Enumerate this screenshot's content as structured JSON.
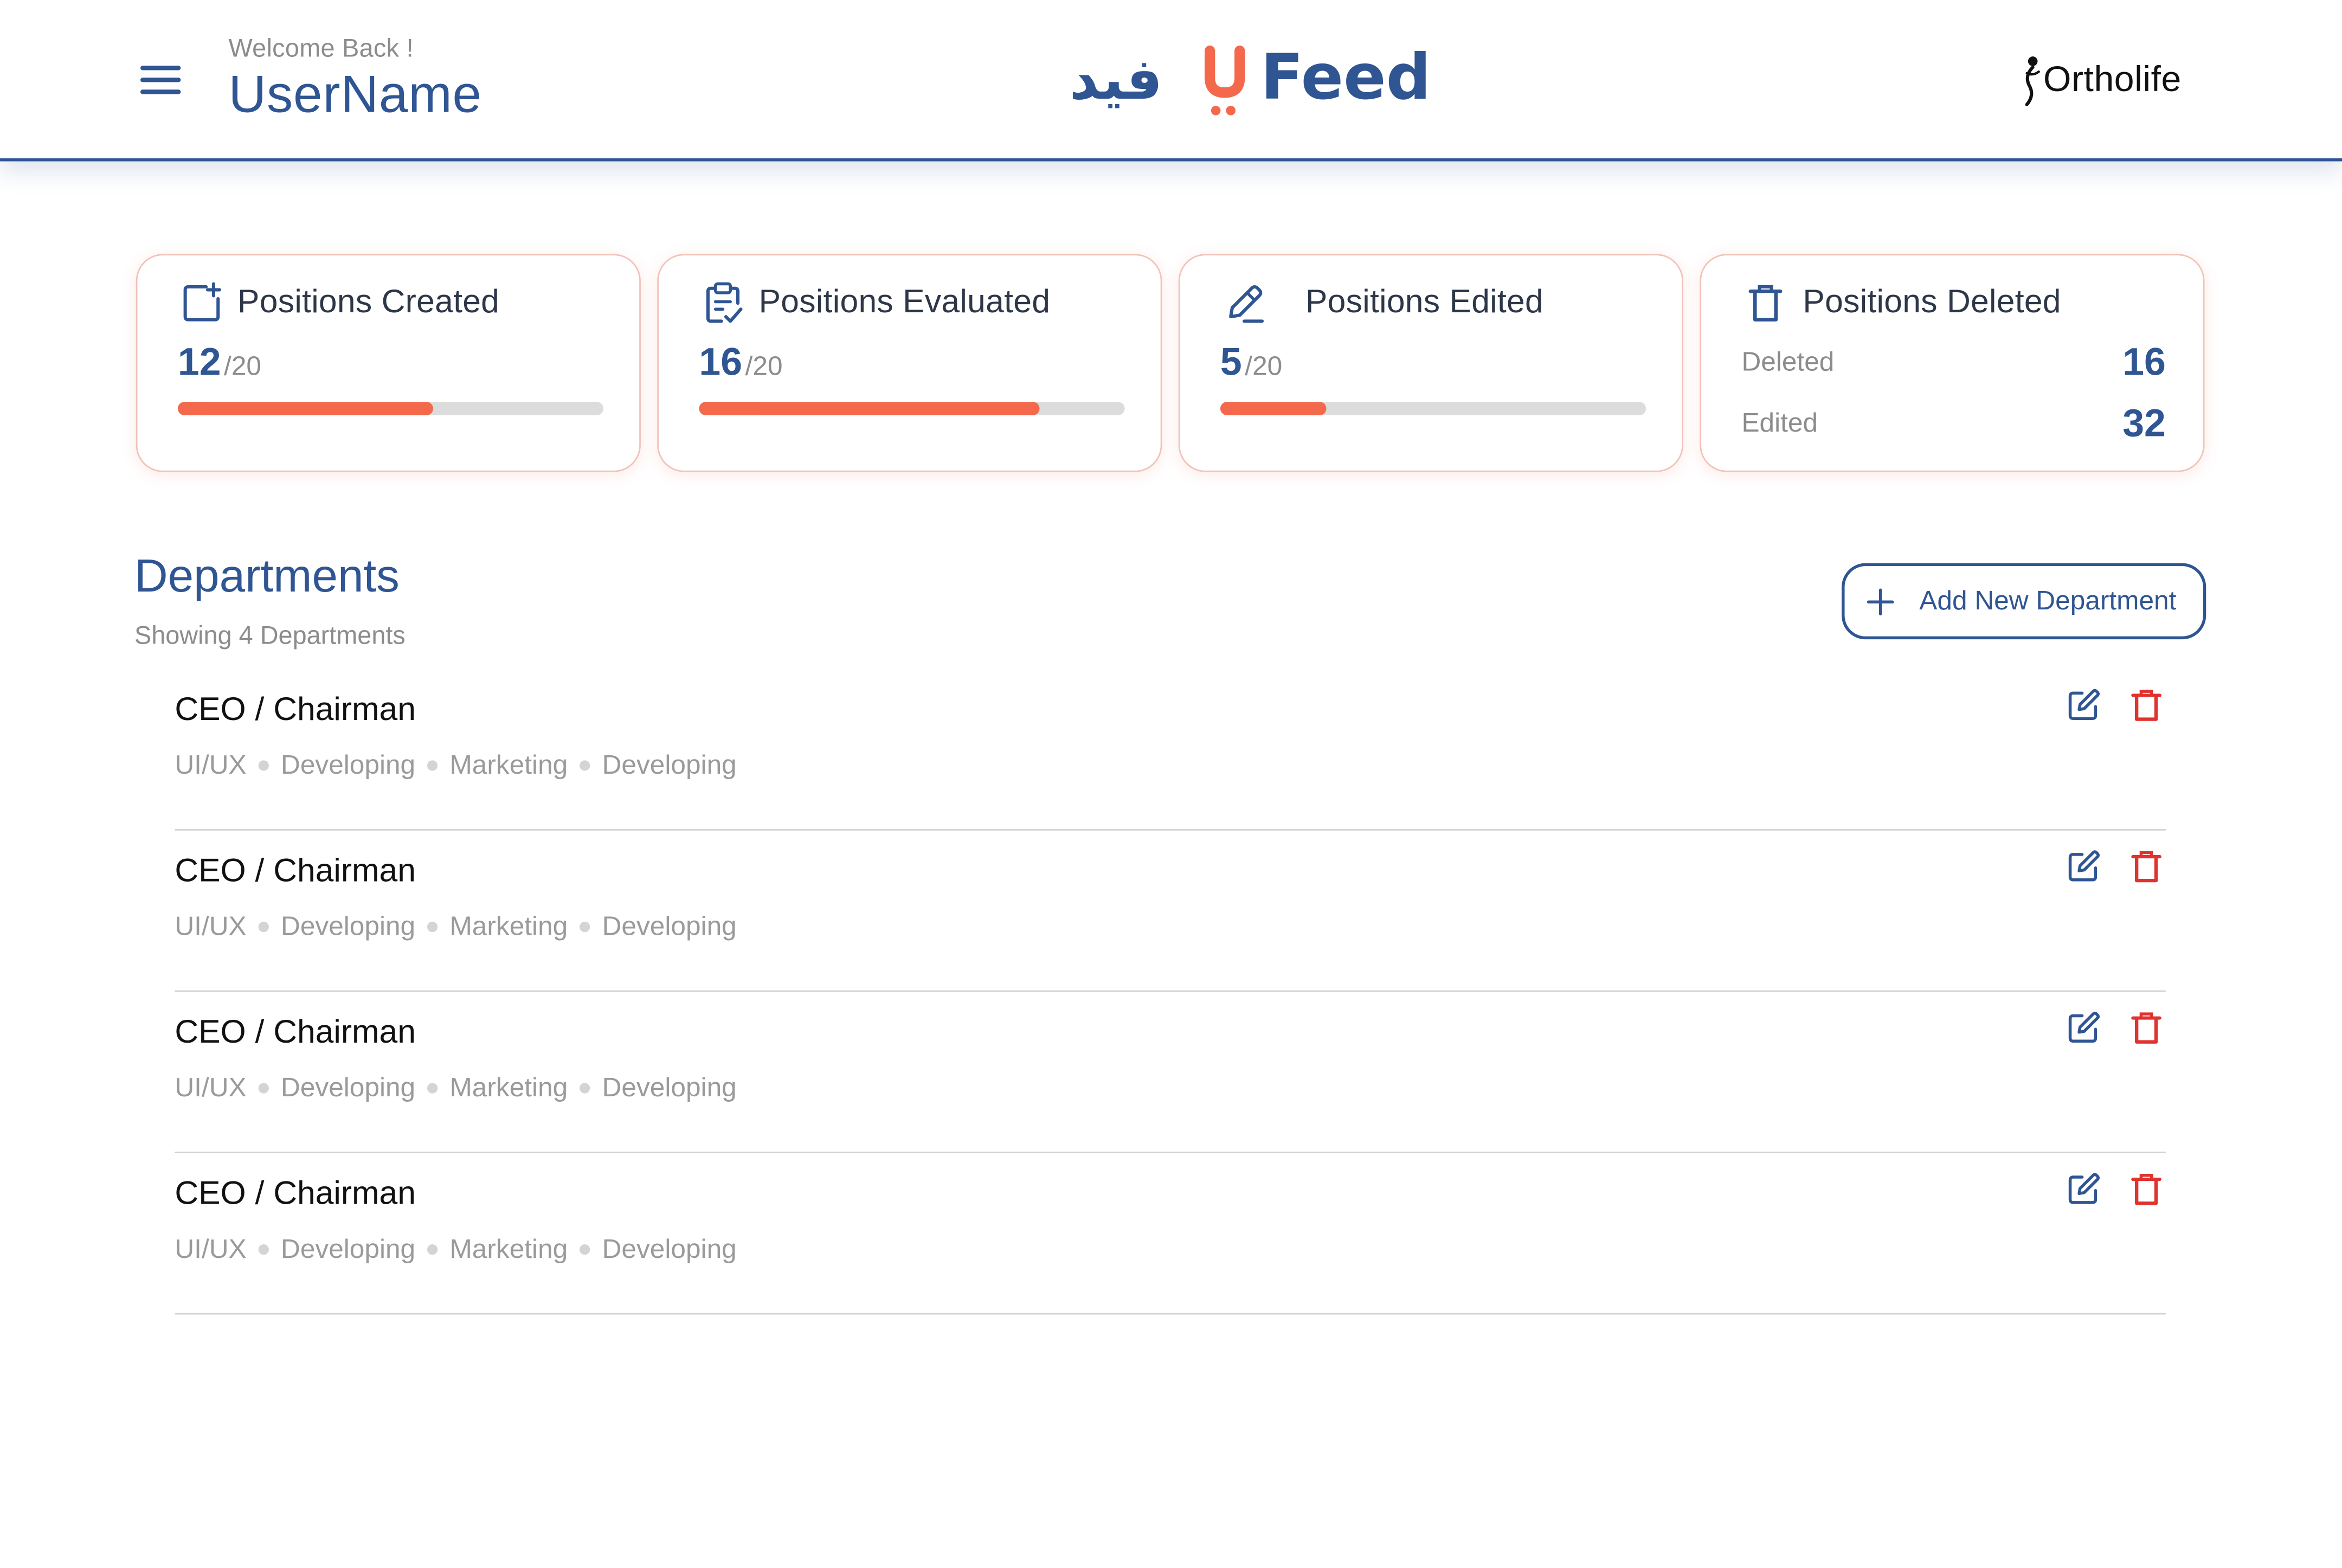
{
  "header": {
    "welcome": "Welcome Back !",
    "username": "UserName",
    "brand_arabic": "فيد",
    "brand_latin": "Feed",
    "partner_logo": "Ortholife",
    "menu_icon": "hamburger-menu-icon"
  },
  "colors": {
    "primary": "#2f5593",
    "accent": "#f4694b",
    "danger": "#e0322f",
    "muted": "#8c8c8c"
  },
  "stats": {
    "created": {
      "title": "Positions Created",
      "value": "12",
      "total": "/20",
      "progress_percent": 60,
      "icon": "add-box-icon"
    },
    "evaluated": {
      "title": "Positions Evaluated",
      "value": "16",
      "total": "/20",
      "progress_percent": 80,
      "icon": "clipboard-check-icon"
    },
    "edited": {
      "title": "Positions Edited",
      "value": "5",
      "total": "/20",
      "progress_percent": 25,
      "icon": "pencil-icon"
    },
    "deleted": {
      "title": "Positions Deleted",
      "icon": "trash-icon",
      "rows": [
        {
          "label": "Deleted",
          "value": "16"
        },
        {
          "label": "Edited",
          "value": "32"
        }
      ]
    }
  },
  "departments": {
    "title": "Departments",
    "subtitle": "Showing 4 Departments",
    "add_button_label": "Add New Department",
    "items": [
      {
        "name": "CEO / Chairman",
        "tags": [
          "UI/UX",
          "Developing",
          "Marketing",
          "Developing"
        ]
      },
      {
        "name": "CEO / Chairman",
        "tags": [
          "UI/UX",
          "Developing",
          "Marketing",
          "Developing"
        ]
      },
      {
        "name": "CEO / Chairman",
        "tags": [
          "UI/UX",
          "Developing",
          "Marketing",
          "Developing"
        ]
      },
      {
        "name": "CEO / Chairman",
        "tags": [
          "UI/UX",
          "Developing",
          "Marketing",
          "Developing"
        ]
      }
    ]
  }
}
